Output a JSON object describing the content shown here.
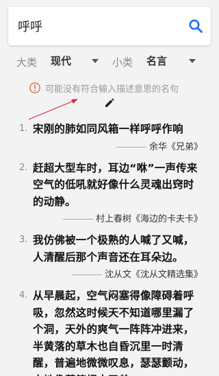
{
  "search": {
    "value": "呼呼"
  },
  "filters": {
    "category_label": "大类",
    "category_value": "现代",
    "subcategory_label": "小类",
    "subcategory_value": "名言"
  },
  "hint": {
    "text": "可能没有符合输入描述意思的名句"
  },
  "colors": {
    "accent": "#1a73e8",
    "hint_icon": "#e06b4a",
    "arrow": "#d9263a"
  },
  "results": [
    {
      "number": "1.",
      "text": "宋刚的肺如同风箱一样呼呼作响",
      "source": "余华《兄弟》"
    },
    {
      "number": "2.",
      "text": "赶超大型车时，耳边“咻”一声传来空气的低吼就好像什么灵魂出窍时的动静。",
      "source": "村上春树《海边的卡夫卡》"
    },
    {
      "number": "3.",
      "text": "我仿佛被一个极熟的人喊了又喊，人清醒后那个声音还在耳朵边。",
      "source": "沈从文《沈从文精选集》"
    },
    {
      "number": "4.",
      "text": "从早晨起，空气闷塞得像障碍着呼吸，忽然这时候天不知道哪里漏了个洞，天外的爽气一阵阵冲进来，半黄落的草木也自昏沉里一时清醒，普遍地微微叹息，瑟瑟颤动，大地像蒸笼揭去了盖。",
      "source": ""
    }
  ]
}
